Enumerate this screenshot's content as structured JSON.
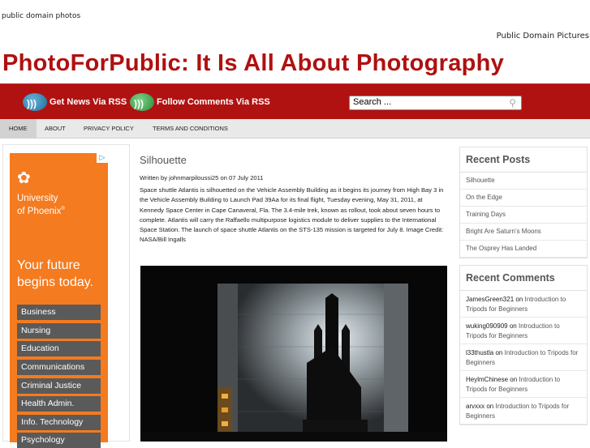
{
  "header": {
    "top_left": "public domain photos",
    "top_right": "Public Domain Pictures",
    "site_title": "PhotoForPublic: It Is All About Photography"
  },
  "redbar": {
    "rss_news": "Get News Via RSS",
    "rss_comments": "Follow Comments Via RSS",
    "search_placeholder": "Search ..."
  },
  "nav": [
    "HOME",
    "ABOUT",
    "PRIVACY POLICY",
    "TERMS AND CONDITIONS"
  ],
  "ad": {
    "uni_line1": "University",
    "uni_line2": "of Phoenix",
    "uni_mark": "®",
    "tag1": "Your future",
    "tag2": "begins today.",
    "buttons": [
      "Business",
      "Nursing",
      "Education",
      "Communications",
      "Criminal Justice",
      "Health Admin.",
      "Info. Technology",
      "Psychology"
    ]
  },
  "post": {
    "title": "Silhouette",
    "meta": "Written by johnmarpiloussi25 on 07 July 2011",
    "body": "Space shuttle Atlantis is silhouetted on the Vehicle Assembly Building as it begins its journey from High Bay 3 in the Vehicle Assembly Building to Launch Pad 39Aa for its final flight, Tuesday evening, May 31, 2011, at Kennedy Space Center in Cape Canaveral, Fla. The 3.4-mile trek, known as rollout, took about seven hours to complete. Atlantis will carry the Raffaello multipurpose logistics module to deliver supplies to the International Space Station. The launch of space shuttle Atlantis on the STS-135 mission is targeted for July 8. Image Credit: NASA/Bill Ingalls"
  },
  "recent_posts": {
    "title": "Recent Posts",
    "items": [
      "Silhouette",
      "On the Edge",
      "Training Days",
      "Bright Are Saturn’s Moons",
      "The Osprey Has Landed"
    ]
  },
  "recent_comments": {
    "title": "Recent Comments",
    "items": [
      {
        "author": "JamesGreen321",
        "on": "on",
        "post": "Introduction to Tripods for Beginners"
      },
      {
        "author": "wuking090909",
        "on": "on",
        "post": "Introduction to Tripods for Beginners"
      },
      {
        "author": "l33thustla",
        "on": "on",
        "post": "Introduction to Tripods for Beginners"
      },
      {
        "author": "HeylmChinese",
        "on": "on",
        "post": "Introduction to Tripods for Beginners"
      },
      {
        "author": "arvxxx",
        "on": "on",
        "post": "Introduction to Tripods for Beginners"
      }
    ]
  },
  "colors": {
    "brand_red": "#b01212",
    "ad_orange": "#f47b20"
  }
}
